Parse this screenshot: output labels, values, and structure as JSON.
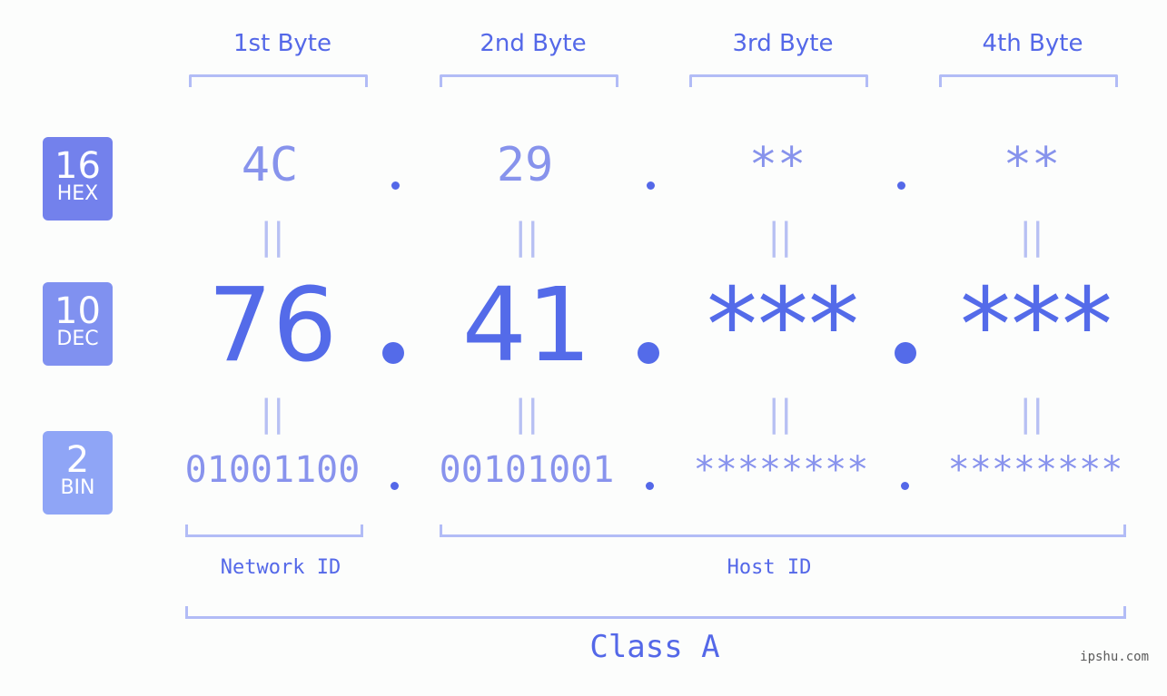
{
  "byte_headers": [
    "1st Byte",
    "2nd Byte",
    "3rd Byte",
    "4th Byte"
  ],
  "badges": [
    {
      "number": "16",
      "label": "HEX",
      "color": "#7381ec"
    },
    {
      "number": "10",
      "label": "DEC",
      "color": "#8091f0"
    },
    {
      "number": "2",
      "label": "BIN",
      "color": "#8fa5f6"
    }
  ],
  "hex": [
    "4C",
    "29",
    "**",
    "**"
  ],
  "dec": [
    "76",
    "41",
    "***",
    "***"
  ],
  "bin": [
    "01001100",
    "00101001",
    "********",
    "********"
  ],
  "equals": "||",
  "network_label": "Network ID",
  "host_label": "Host ID",
  "class_label": "Class A",
  "watermark": "ipshu.com"
}
